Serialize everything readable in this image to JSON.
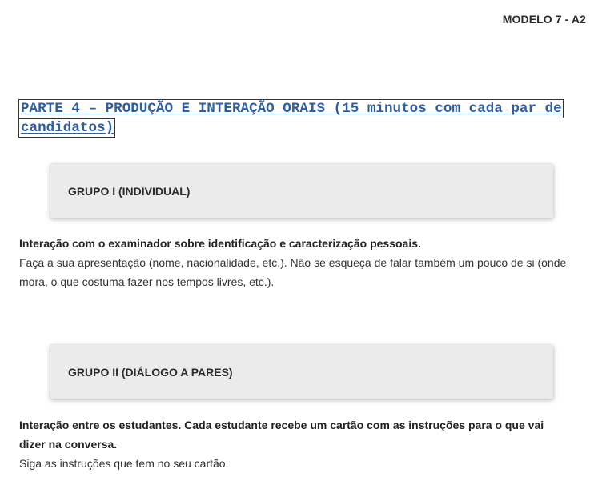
{
  "header": {
    "model_label": "MODELO 7 - A2"
  },
  "part": {
    "heading": "PARTE 4 – PRODUÇÃO E INTERAÇÃO ORAIS (15 minutos com cada par de candidatos)"
  },
  "groups": [
    {
      "title": "GRUPO I (INDIVIDUAL)",
      "lead": "Interação com o examinador sobre identificação e caracterização pessoais.",
      "body": "Faça a sua apresentação (nome, nacionalidade, etc.). Não se esqueça de falar também um pouco de si (onde mora, o que costuma fazer nos tempos livres, etc.)."
    },
    {
      "title": "GRUPO II (DIÁLOGO A PARES)",
      "lead": "Interação entre os estudantes. Cada estudante recebe um cartão com as instruções para o que vai dizer na conversa.",
      "body": "Siga as instruções que tem no seu cartão."
    }
  ]
}
